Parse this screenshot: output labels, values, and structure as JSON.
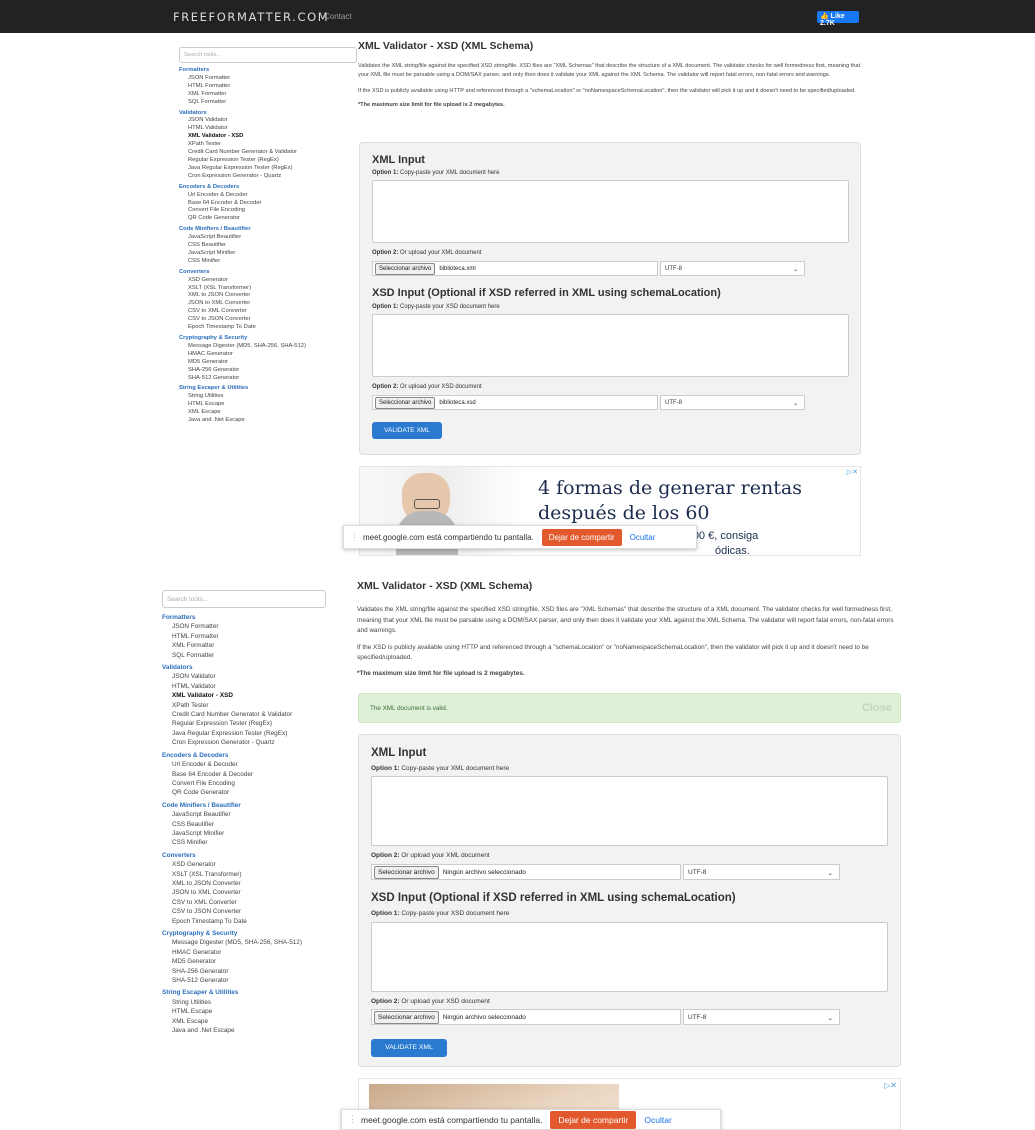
{
  "topbar": {
    "brand": "FREEFORMATTER.COM",
    "contact": "Contact",
    "like": "Like 2.7K"
  },
  "search_placeholder": "Search tools...",
  "sidebar": [
    {
      "title": "Formatters",
      "items": [
        "JSON Formatter",
        "HTML Formatter",
        "XML Formatter",
        "SQL Formatter"
      ]
    },
    {
      "title": "Validators",
      "items": [
        "JSON Validator",
        "HTML Validator",
        "XML Validator - XSD",
        "XPath Tester",
        "Credit Card Number Generator & Validator",
        "Regular Expression Tester (RegEx)",
        "Java Regular Expression Tester (RegEx)",
        "Cron Expression Generator - Quartz"
      ]
    },
    {
      "title": "Encoders & Decoders",
      "items": [
        "Url Encoder & Decoder",
        "Base 64 Encoder & Decoder",
        "Convert File Encoding",
        "QR Code Generator"
      ]
    },
    {
      "title": "Code Minifiers / Beautifier",
      "items": [
        "JavaScript Beautifier",
        "CSS Beautifier",
        "JavaScript Minifier",
        "CSS Minifier"
      ]
    },
    {
      "title": "Converters",
      "items": [
        "XSD Generator",
        "XSLT (XSL Transformer)",
        "XML to JSON Converter",
        "JSON to XML Converter",
        "CSV to XML Converter",
        "CSV to JSON Converter",
        "Epoch Timestamp To Date"
      ]
    },
    {
      "title": "Cryptography & Security",
      "items": [
        "Message Digester (MD5, SHA-256, SHA-512)",
        "HMAC Generator",
        "MD5 Generator",
        "SHA-256 Generator",
        "SHA-512 Generator"
      ]
    },
    {
      "title": "String Escaper & Utilities",
      "items": [
        "String Utilities",
        "HTML Escape",
        "XML Escape",
        "Java and .Net Escape"
      ]
    }
  ],
  "active_item": "XML Validator - XSD",
  "page": {
    "title": "XML Validator - XSD (XML Schema)",
    "desc1": "Validates the XML string/file against the specified XSD string/file. XSD files are \"XML Schemas\" that describe the structure of a XML document. The validator checks for well formedness first, meaning that your XML file must be parsable using a DOM/SAX parser, and only then does it validate your XML against the XML Schema. The validator will report fatal errors, non-fatal errors and warnings.",
    "desc2": "If the XSD is publicly available using HTTP and referenced through a \"schemaLocation\" or \"noNamespaceSchemaLocation\", then the validator will pick it up and it doesn't need to be specified/uploaded.",
    "limit": "*The maximum size limit for file upload is 2 megabytes.",
    "xml_heading": "XML Input",
    "xsd_heading": "XSD Input (Optional if XSD referred in XML using schemaLocation)",
    "opt1_bold": "Option 1:",
    "opt1_xml": " Copy-paste your XML document here",
    "opt1_xsd": " Copy-paste your XSD document here",
    "opt2_bold": "Option 2:",
    "opt2_xml": " Or upload your XML document",
    "opt2_xsd": " Or upload your XSD document",
    "file_button": "Seleccionar archivo",
    "encoding": "UTF-8",
    "validate": "VALIDATE XML"
  },
  "top_view": {
    "xml_file": "biblioteca.xml",
    "xsd_file": "biblioteca.xsd"
  },
  "bottom_view": {
    "xml_file": "Ningún archivo seleccionado",
    "xsd_file": "Ningún archivo seleccionado",
    "alert": "The XML document is valid.",
    "close": "Close"
  },
  "ad": {
    "headline1": "4 formas de generar rentas",
    "headline2": "después de los 60",
    "sub1": "de 500.000 €, consiga",
    "sub2": "ódicas."
  },
  "sharebar": {
    "msg": "meet.google.com está compartiendo tu pantalla.",
    "stop": "Dejar de compartir",
    "hide": "Ocultar"
  }
}
